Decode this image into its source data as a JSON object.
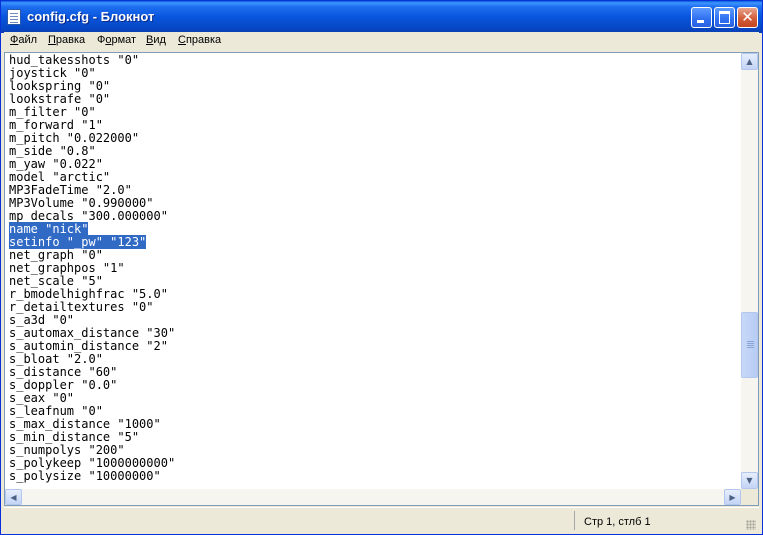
{
  "window": {
    "title": "config.cfg - Блокнот",
    "close_glyph": "✕",
    "icons": [
      "notepad-icon",
      "minimize-icon",
      "maximize-icon",
      "close-icon"
    ]
  },
  "menu": [
    {
      "label": "Файл",
      "underline_index": 0
    },
    {
      "label": "Правка",
      "underline_index": 0
    },
    {
      "label": "Формат",
      "underline_index": 1
    },
    {
      "label": "Вид",
      "underline_index": 0
    },
    {
      "label": "Справка",
      "underline_index": 0
    }
  ],
  "editor": {
    "lines": [
      "hud_takesshots \"0\"",
      "joystick \"0\"",
      "lookspring \"0\"",
      "lookstrafe \"0\"",
      "m_filter \"0\"",
      "m_forward \"1\"",
      "m_pitch \"0.022000\"",
      "m_side \"0.8\"",
      "m_yaw \"0.022\"",
      "model \"arctic\"",
      "MP3FadeTime \"2.0\"",
      "MP3Volume \"0.990000\"",
      "mp_decals \"300.000000\"",
      "name \"nick\"",
      "setinfo \"_pw\" \"123\"",
      "net_graph \"0\"",
      "net_graphpos \"1\"",
      "net_scale \"5\"",
      "r_bmodelhighfrac \"5.0\"",
      "r_detailtextures \"0\"",
      "s_a3d \"0\"",
      "s_automax_distance \"30\"",
      "s_automin_distance \"2\"",
      "s_bloat \"2.0\"",
      "s_distance \"60\"",
      "s_doppler \"0.0\"",
      "s_eax \"0\"",
      "s_leafnum \"0\"",
      "s_max_distance \"1000\"",
      "s_min_distance \"5\"",
      "s_numpolys \"200\"",
      "s_polykeep \"1000000000\"",
      "s_polysize \"10000000\""
    ],
    "selected_lines": [
      13,
      14
    ],
    "selection_color": "#316ac5"
  },
  "scrollbars": {
    "vertical_position": 0.72,
    "icons": [
      "scroll-up-arrow-icon",
      "scroll-down-arrow-icon",
      "scroll-left-arrow-icon",
      "scroll-right-arrow-icon"
    ]
  },
  "statusbar": {
    "position": "Стр 1, стлб 1"
  },
  "colors": {
    "titlebar": "#0855dd",
    "chrome": "#ece9d8",
    "text": "#000000"
  }
}
